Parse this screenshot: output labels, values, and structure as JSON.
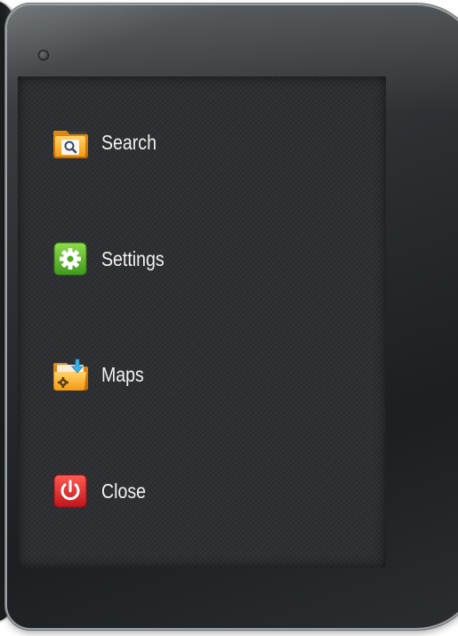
{
  "menu": {
    "items": [
      {
        "label": "Search",
        "icon": "search-folder-icon"
      },
      {
        "label": "Settings",
        "icon": "gear-icon"
      },
      {
        "label": "Maps",
        "icon": "folder-download-icon"
      },
      {
        "label": "Close",
        "icon": "power-icon"
      }
    ]
  },
  "colors": {
    "screen_bg": "#2e3033",
    "folder_orange": "#f7a21b",
    "settings_green": "#5cb82e",
    "close_red": "#d8232a",
    "label_text": "#f2f2f2"
  }
}
